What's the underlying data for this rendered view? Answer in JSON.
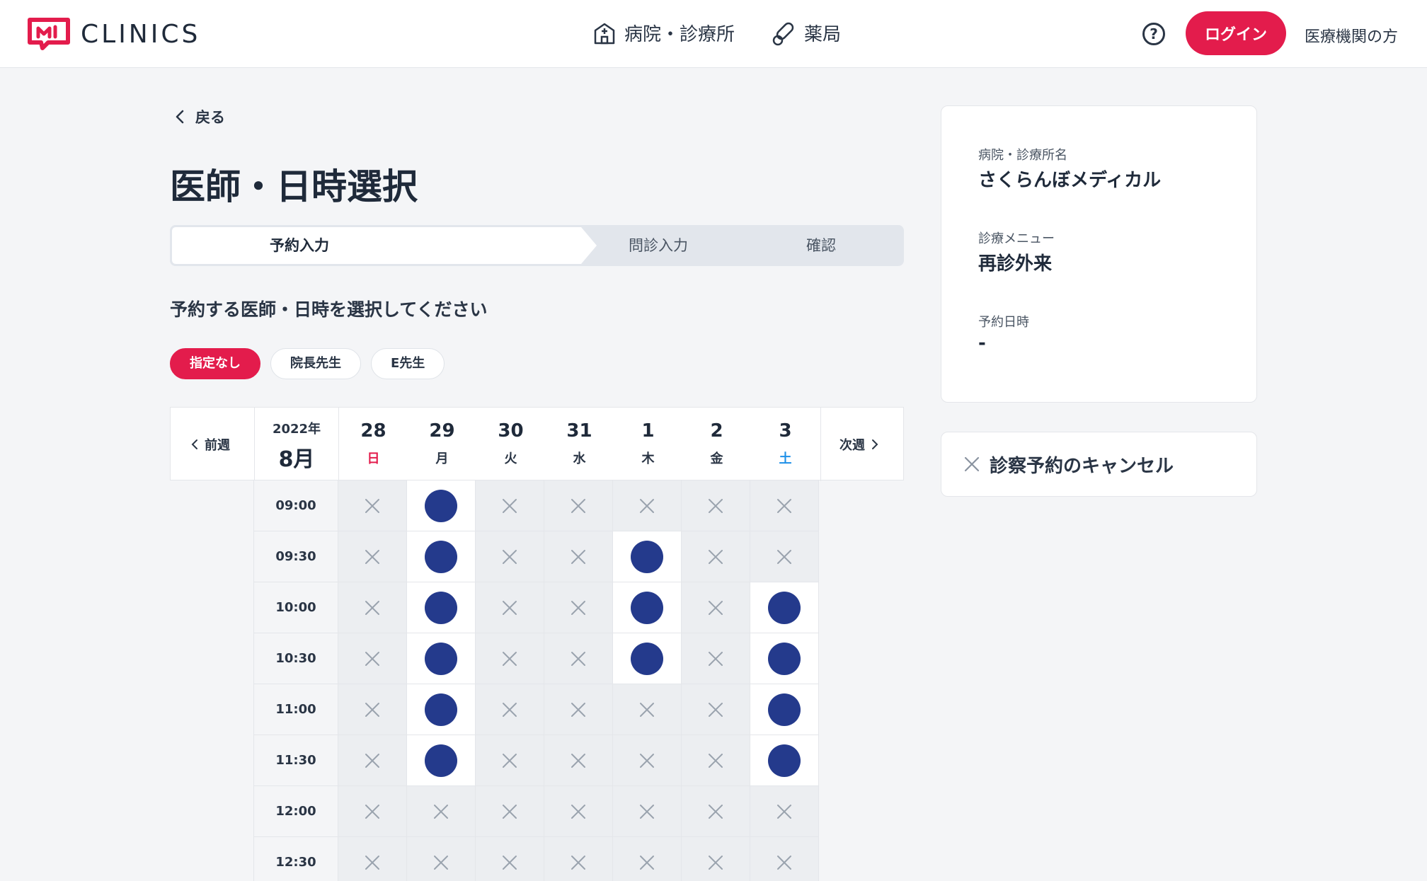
{
  "header": {
    "logo_text": "CLINICS",
    "nav": [
      {
        "label": "病院・診療所",
        "icon": "hospital-icon"
      },
      {
        "label": "薬局",
        "icon": "pill-icon"
      }
    ],
    "help_icon": "?",
    "login_label": "ログイン",
    "medical_link": "医療機関の方"
  },
  "back_label": "戻る",
  "page_title": "医師・日時選択",
  "steps": [
    "予約入力",
    "問診入力",
    "確認"
  ],
  "instruction": "予約する医師・日時を選択してください",
  "doctors": [
    {
      "label": "指定なし",
      "selected": true
    },
    {
      "label": "院長先生",
      "selected": false
    },
    {
      "label": "E先生",
      "selected": false
    }
  ],
  "calendar": {
    "prev_label": "前週",
    "next_label": "次週",
    "year": "2022年",
    "month": "8月",
    "days": [
      {
        "num": "28",
        "wd": "日"
      },
      {
        "num": "29",
        "wd": "月"
      },
      {
        "num": "30",
        "wd": "火"
      },
      {
        "num": "31",
        "wd": "水"
      },
      {
        "num": "1",
        "wd": "木"
      },
      {
        "num": "2",
        "wd": "金"
      },
      {
        "num": "3",
        "wd": "土"
      }
    ],
    "times": [
      "09:00",
      "09:30",
      "10:00",
      "10:30",
      "11:00",
      "11:30",
      "12:00",
      "12:30"
    ],
    "availability": [
      [
        0,
        1,
        0,
        0,
        0,
        0,
        0
      ],
      [
        0,
        1,
        0,
        0,
        1,
        0,
        0
      ],
      [
        0,
        1,
        0,
        0,
        1,
        0,
        1
      ],
      [
        0,
        1,
        0,
        0,
        1,
        0,
        1
      ],
      [
        0,
        1,
        0,
        0,
        0,
        0,
        1
      ],
      [
        0,
        1,
        0,
        0,
        0,
        0,
        1
      ],
      [
        0,
        0,
        0,
        0,
        0,
        0,
        0
      ],
      [
        0,
        0,
        0,
        0,
        0,
        0,
        0
      ]
    ]
  },
  "summary": {
    "clinic_label": "病院・診療所名",
    "clinic_value": "さくらんぼメディカル",
    "menu_label": "診療メニュー",
    "menu_value": "再診外来",
    "datetime_label": "予約日時",
    "datetime_value": "-"
  },
  "cancel_label": "診察予約のキャンセル",
  "colors": {
    "accent": "#e31c4c",
    "slot_available": "#243a8c",
    "saturday": "#1e90e8"
  }
}
